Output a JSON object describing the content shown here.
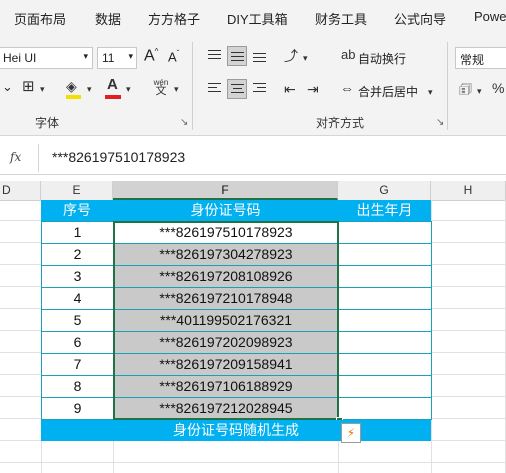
{
  "tabs": [
    "页面布局",
    "数据",
    "方方格子",
    "DIY工具箱",
    "财务工具",
    "公式向导",
    "Powe"
  ],
  "ribbon": {
    "font_name": "Hei UI",
    "font_size": "11",
    "grow_font": "A",
    "shrink_font": "A",
    "font_color_letter": "A",
    "fill_color_hex": "#f2e000",
    "font_color_hex": "#e02020",
    "phonetic_top": "wén",
    "phonetic_bottom": "文",
    "wrap_text": "自动换行",
    "merge_center": "合并后居中",
    "number_format": "常规",
    "group_font": "字体",
    "group_alignment": "对齐方式"
  },
  "formula_bar": {
    "fx": "fx",
    "value": "***826197510178923"
  },
  "columns": [
    "D",
    "E",
    "F",
    "G",
    "H"
  ],
  "table": {
    "headers": [
      "序号",
      "身份证号码",
      "出生年月"
    ],
    "rows": [
      {
        "n": "1",
        "id": "***826197510178923"
      },
      {
        "n": "2",
        "id": "***826197304278923"
      },
      {
        "n": "3",
        "id": "***826197208108926"
      },
      {
        "n": "4",
        "id": "***826197210178948"
      },
      {
        "n": "5",
        "id": "***401199502176321"
      },
      {
        "n": "6",
        "id": "***826197202098923"
      },
      {
        "n": "7",
        "id": "***826197209158941"
      },
      {
        "n": "8",
        "id": "***826197106188929"
      },
      {
        "n": "9",
        "id": "***826197212028945"
      }
    ],
    "footer": "身份证号码随机生成"
  },
  "colors": {
    "header_fill": "#00b0f0",
    "selection_fill": "#c9c9c9",
    "border": "#1aa1b8"
  }
}
